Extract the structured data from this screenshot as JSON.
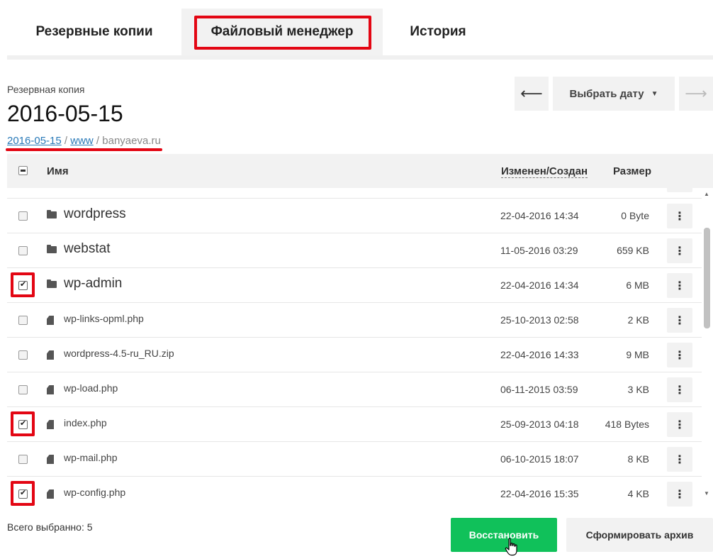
{
  "tabs": [
    {
      "label": "Резервные копии"
    },
    {
      "label": "Файловый менеджер"
    },
    {
      "label": "История"
    }
  ],
  "header": {
    "subtitle": "Резервная копия",
    "title": "2016-05-15",
    "breadcrumb": {
      "part1": "2016-05-15",
      "sep1": " / ",
      "part2": "www",
      "sep2": " / ",
      "part3": "banyaeva.ru"
    }
  },
  "date_nav": {
    "prev_label": "⟵",
    "select_label": "Выбрать дату",
    "next_label": "⟶"
  },
  "table": {
    "columns": {
      "name": "Имя",
      "modified": "Изменен/Создан",
      "size": "Размер"
    },
    "rows": [
      {
        "type": "folder",
        "name": "wordpress",
        "date": "22-04-2016 14:34",
        "size": "0 Byte",
        "checked": false
      },
      {
        "type": "folder",
        "name": "webstat",
        "date": "11-05-2016 03:29",
        "size": "659 KB",
        "checked": false
      },
      {
        "type": "folder",
        "name": "wp-admin",
        "date": "22-04-2016 14:34",
        "size": "6 MB",
        "checked": true
      },
      {
        "type": "file",
        "name": "wp-links-opml.php",
        "date": "25-10-2013 02:58",
        "size": "2 KB",
        "checked": false
      },
      {
        "type": "file",
        "name": "wordpress-4.5-ru_RU.zip",
        "date": "22-04-2016 14:33",
        "size": "9 MB",
        "checked": false
      },
      {
        "type": "file",
        "name": "wp-load.php",
        "date": "06-11-2015 03:59",
        "size": "3 KB",
        "checked": false
      },
      {
        "type": "file",
        "name": "index.php",
        "date": "25-09-2013 04:18",
        "size": "418 Bytes",
        "checked": true
      },
      {
        "type": "file",
        "name": "wp-mail.php",
        "date": "06-10-2015 18:07",
        "size": "8 KB",
        "checked": false
      },
      {
        "type": "file",
        "name": "wp-config.php",
        "date": "22-04-2016 15:35",
        "size": "4 KB",
        "checked": true
      }
    ],
    "row_menu_label": "⋮"
  },
  "footer": {
    "selected_text": "Всего выбранно: 5",
    "restore_label": "Восстановить",
    "archive_label": "Сформировать архив"
  },
  "colors": {
    "accent_green": "#10c15a",
    "highlight_red": "#e30613",
    "link_blue": "#2a7ab8"
  }
}
